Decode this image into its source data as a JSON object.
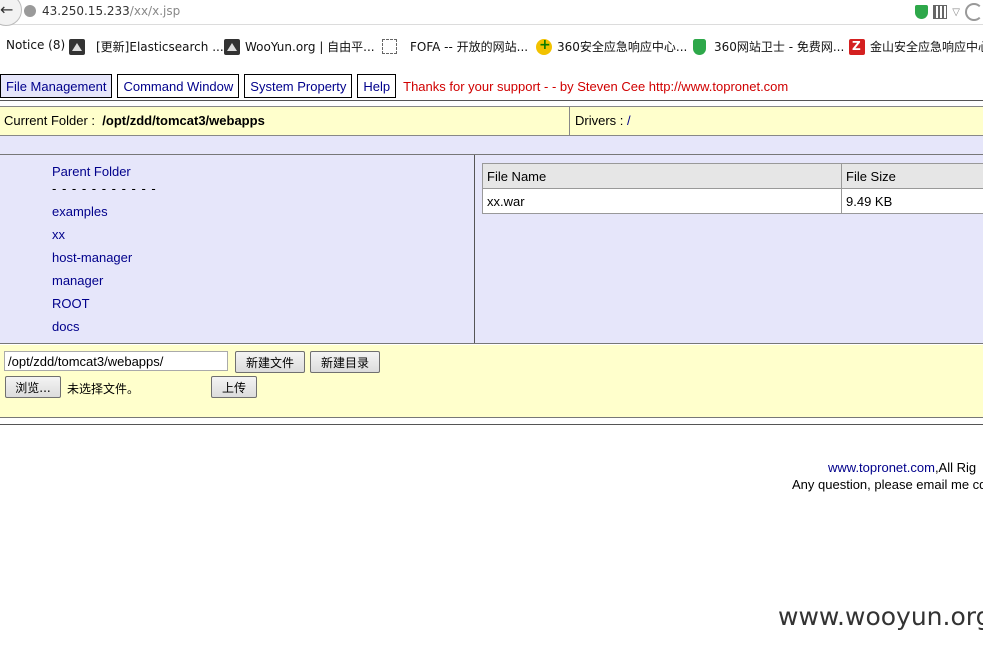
{
  "browser": {
    "url_host": "43.250.15.233",
    "url_path": "/xx/x.jsp"
  },
  "bookmarks": [
    {
      "label": "Notice (8)",
      "icon": "none"
    },
    {
      "label": "[更新]Elasticsearch ...",
      "icon": "wooyun-icon"
    },
    {
      "label": "WooYun.org | 自由平...",
      "icon": "wooyun-icon"
    },
    {
      "label": "FOFA -- 开放的网站...",
      "icon": "dashed-box-icon"
    },
    {
      "label": "360安全应急响应中心...",
      "icon": "360-icon"
    },
    {
      "label": "360网站卫士 - 免费网...",
      "icon": "shield-icon"
    },
    {
      "label": "金山安全应急响应中心",
      "icon": "kingsoft-icon"
    }
  ],
  "nav": {
    "items": [
      "File Management",
      "Command Window",
      "System Property",
      "Help"
    ],
    "thanks": "Thanks for your support - - by Steven Cee http://www.topronet.com"
  },
  "folder": {
    "label": "Current Folder :",
    "path": "/opt/zdd/tomcat3/webapps",
    "drivers_label": "Drivers :",
    "drive": "/"
  },
  "tree": {
    "parent": "Parent Folder",
    "separator": "- - - - - - - - - - -",
    "folders": [
      "examples",
      "xx",
      "host-manager",
      "manager",
      "ROOT",
      "docs"
    ]
  },
  "files": {
    "headers": [
      "File Name",
      "File Size"
    ],
    "rows": [
      {
        "name": "xx.war",
        "size": "9.49 KB"
      }
    ]
  },
  "upload": {
    "path_value": "/opt/zdd/tomcat3/webapps/",
    "new_file": "新建文件",
    "new_dir": "新建目录",
    "browse": "浏览...",
    "no_file": "未选择文件。",
    "upload": "上传"
  },
  "footer": {
    "link": "www.topronet.com",
    "rights": ",All Rig",
    "question": "Any question, please email me cq"
  },
  "watermark": "www.wooyun.org"
}
